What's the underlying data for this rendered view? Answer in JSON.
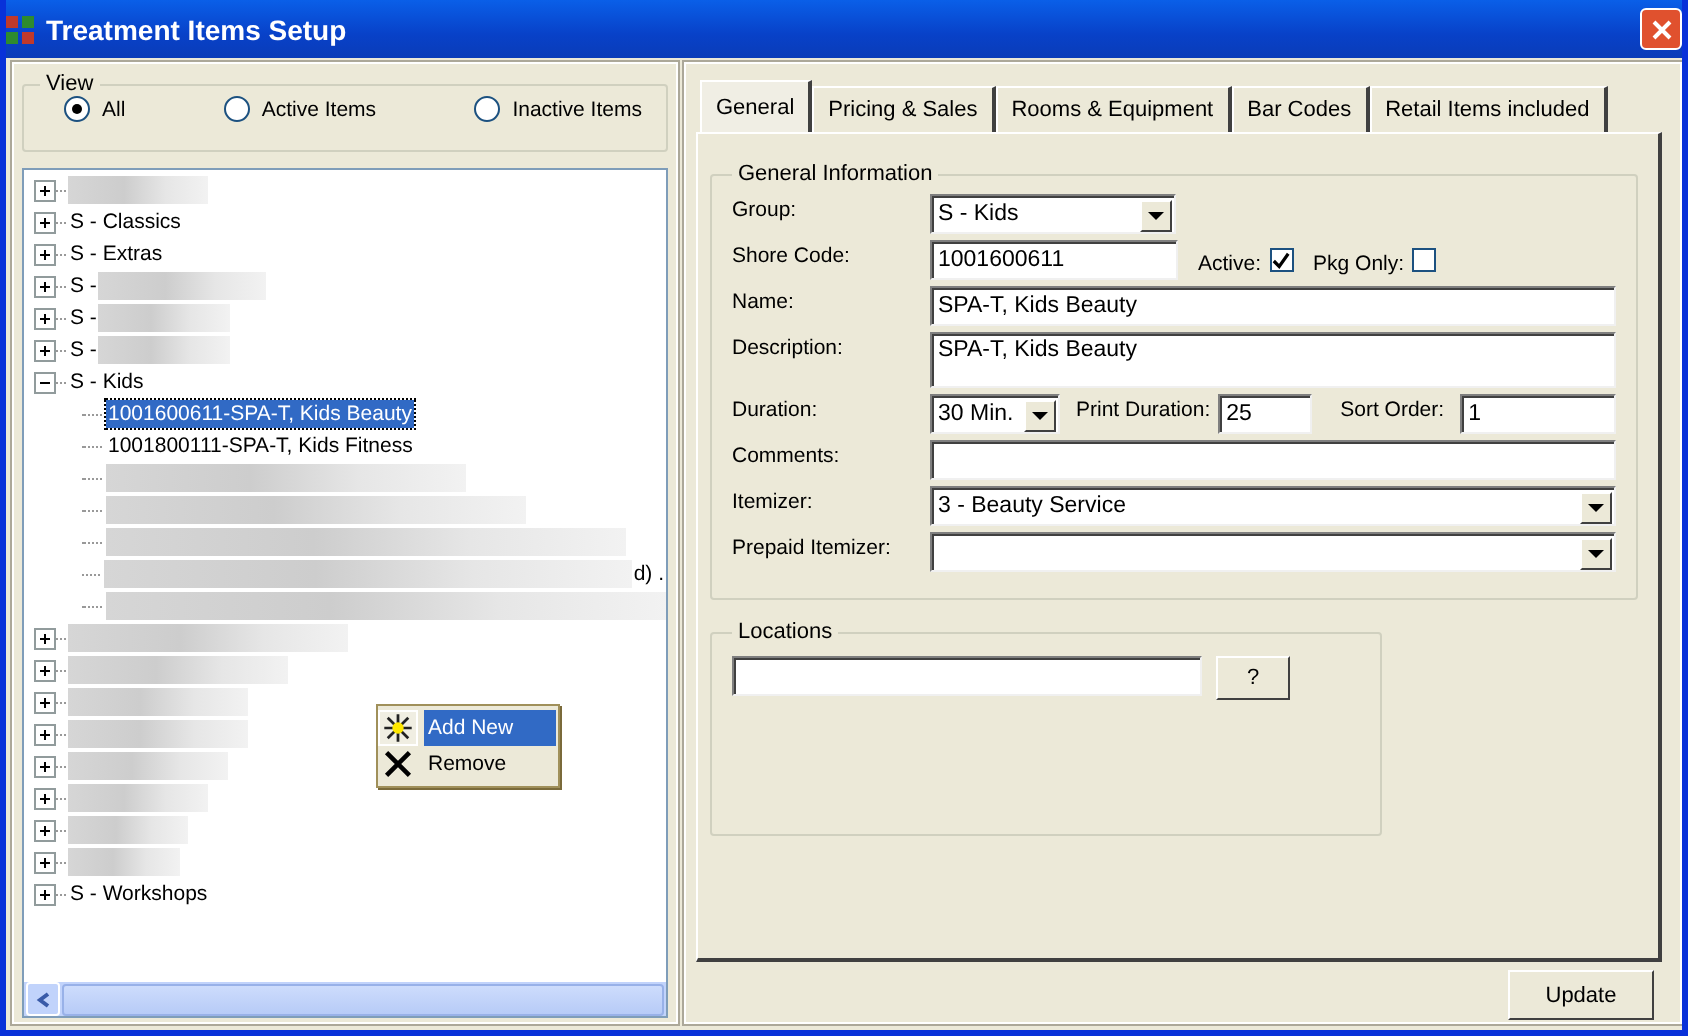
{
  "window": {
    "title": "Treatment Items Setup"
  },
  "view": {
    "label": "View",
    "options": [
      {
        "label": "All",
        "selected": true
      },
      {
        "label": "Active Items",
        "selected": false
      },
      {
        "label": "Inactive Items",
        "selected": false
      }
    ]
  },
  "tree": {
    "items": [
      {
        "redacted": true,
        "expanded": false
      },
      {
        "label": "S - Classics",
        "expanded": false
      },
      {
        "label": "S - Extras",
        "expanded": false
      },
      {
        "label": "S -",
        "redacted": true,
        "expanded": false
      },
      {
        "label": "S -",
        "redacted": true,
        "expanded": false
      },
      {
        "label": "S -",
        "redacted": true,
        "expanded": false
      },
      {
        "label": "S - Kids",
        "expanded": true,
        "children": [
          {
            "label": "1001600611-SPA-T, Kids Beauty",
            "selected": true
          },
          {
            "label": "1001800111-SPA-T, Kids Fitness",
            "selected": false
          },
          {
            "redacted": true,
            "selected": false
          },
          {
            "redacted": true,
            "selected": false
          },
          {
            "redacted": true,
            "selected": false
          },
          {
            "redacted": true,
            "tail": "d) .",
            "selected": false
          },
          {
            "redacted": true,
            "selected": false
          }
        ]
      },
      {
        "redacted": true,
        "expanded": false
      },
      {
        "redacted": true,
        "expanded": false
      },
      {
        "redacted": true,
        "expanded": false
      },
      {
        "redacted": true,
        "expanded": false
      },
      {
        "redacted": true,
        "expanded": false
      },
      {
        "redacted": true,
        "expanded": false
      },
      {
        "redacted": true,
        "expanded": false
      },
      {
        "redacted": true,
        "expanded": false
      },
      {
        "label": "S - Workshops",
        "expanded": false
      }
    ]
  },
  "context_menu": {
    "items": [
      {
        "kind": "add",
        "label": "Add New",
        "selected": true
      },
      {
        "kind": "remove",
        "label": "Remove",
        "selected": false
      }
    ]
  },
  "tabs": [
    {
      "label": "General",
      "selected": true
    },
    {
      "label": "Pricing & Sales",
      "selected": false
    },
    {
      "label": "Rooms & Equipment",
      "selected": false
    },
    {
      "label": "Bar Codes",
      "selected": false
    },
    {
      "label": "Retail Items included",
      "selected": false
    }
  ],
  "general_information": {
    "title": "General Information",
    "group": {
      "label": "Group:",
      "value": "S - Kids"
    },
    "shore_code": {
      "label": "Shore Code:",
      "value": "1001600611"
    },
    "active": {
      "label": "Active:",
      "checked": true
    },
    "pkg_only": {
      "label": "Pkg Only:",
      "checked": false
    },
    "name": {
      "label": "Name:",
      "value": "SPA-T, Kids Beauty"
    },
    "description": {
      "label": "Description:",
      "value": "SPA-T, Kids Beauty"
    },
    "duration": {
      "label": "Duration:",
      "value": "30 Min."
    },
    "print_duration": {
      "label": "Print Duration:",
      "value": "25"
    },
    "sort_order": {
      "label": "Sort Order:",
      "value": "1"
    },
    "comments": {
      "label": "Comments:"
    },
    "itemizer": {
      "label": "Itemizer:",
      "value": "3 - Beauty Service"
    },
    "prepaid_itemizer": {
      "label": "Prepaid Itemizer:"
    }
  },
  "locations": {
    "title": "Locations",
    "button": "?"
  },
  "update_button": "Update"
}
